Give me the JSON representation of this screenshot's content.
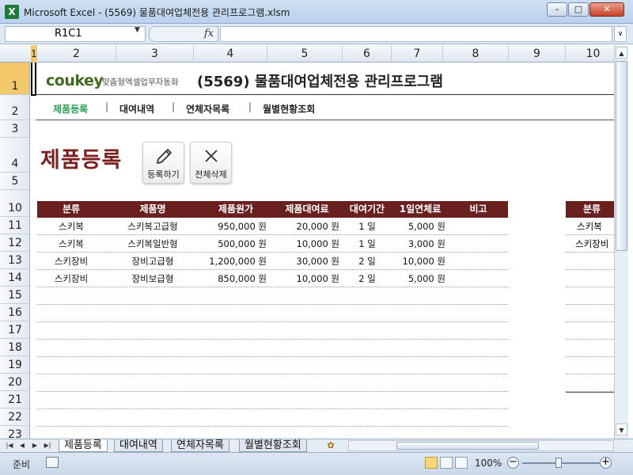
{
  "window": {
    "title": "Microsoft Excel - (5569) 물품대여업체전용 관리프로그램.xlsm",
    "app_icon_label": "X",
    "min_glyph": "–",
    "max_glyph": "□",
    "close_glyph": "✕"
  },
  "formula_bar": {
    "name_box": "R1C1",
    "fx": "fx",
    "formula": ""
  },
  "columns": [
    "1",
    "2",
    "3",
    "4",
    "5",
    "6",
    "7",
    "8",
    "9",
    "10"
  ],
  "rows": [
    "1",
    "2",
    "3",
    "4",
    "5",
    "10",
    "11",
    "12",
    "13",
    "14",
    "15",
    "16",
    "17",
    "18",
    "19",
    "20",
    "21",
    "22",
    "23"
  ],
  "header": {
    "logo_brand": "coukey",
    "logo_sub": "맞춤형엑셀업무자동화",
    "doc_title": "(5569) 물품대여업체전용 관리프로그램"
  },
  "nav": {
    "items": [
      "제품등록",
      "대여내역",
      "연체자목록",
      "월별현황조회"
    ],
    "separator": "|"
  },
  "page": {
    "heading": "제품등록",
    "register_label": "등록하기",
    "delete_all_label": "전체삭제"
  },
  "table": {
    "headers": [
      "분류",
      "제품명",
      "제품원가",
      "제품대여료",
      "대여기간",
      "1일연체료",
      "비고"
    ],
    "rows": [
      {
        "category": "스키복",
        "name": "스키복고급형",
        "cost": "950,000 원",
        "fee": "20,000 원",
        "days": "1 일",
        "late": "5,000 원",
        "note": ""
      },
      {
        "category": "스키복",
        "name": "스키복일반형",
        "cost": "500,000 원",
        "fee": "10,000 원",
        "days": "1 일",
        "late": "3,000 원",
        "note": ""
      },
      {
        "category": "스키장비",
        "name": "장비고급형",
        "cost": "1,200,000 원",
        "fee": "30,000 원",
        "days": "2 일",
        "late": "10,000 원",
        "note": ""
      },
      {
        "category": "스키장비",
        "name": "장비보급형",
        "cost": "850,000 원",
        "fee": "10,000 원",
        "days": "2 일",
        "late": "5,000 원",
        "note": ""
      }
    ]
  },
  "side_table": {
    "header": "분류",
    "rows": [
      "스키복",
      "스키장비"
    ]
  },
  "sheet_tabs": [
    "제품등록",
    "대여내역",
    "연체자목록",
    "월별현황조회"
  ],
  "status": {
    "ready": "준비",
    "zoom": "100%",
    "zoom_out": "−",
    "zoom_in": "+"
  },
  "colors": {
    "accent_header": "#6b2020",
    "heading_red": "#7b2020",
    "nav_active": "#2e9e55"
  }
}
